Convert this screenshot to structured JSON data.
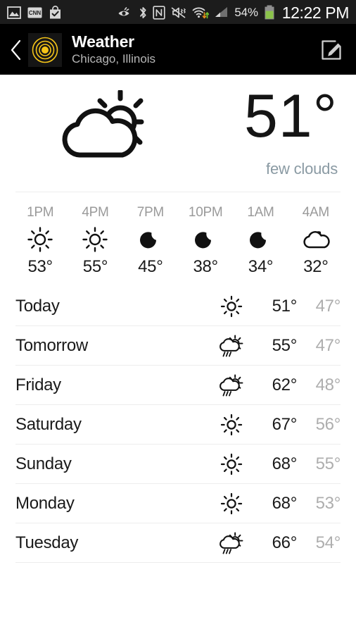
{
  "statusbar": {
    "left_icons": [
      {
        "name": "gallery-image-icon"
      },
      {
        "name": "cnn-news-icon"
      },
      {
        "name": "play-store-bag-icon"
      }
    ],
    "right_icons": [
      {
        "name": "smart-stay-eye-icon"
      },
      {
        "name": "bluetooth-icon"
      },
      {
        "name": "nfc-icon"
      },
      {
        "name": "sound-mute-vibrate-icon"
      },
      {
        "name": "wifi-data-transfer-icon"
      },
      {
        "name": "cellular-signal-icon"
      }
    ],
    "battery_percent": "54%",
    "battery_icon": "battery-icon",
    "battery_color": "#8bc34a",
    "time": "12:22 PM"
  },
  "header": {
    "back_icon": "back-chevron-icon",
    "app_icon": "weather-target-icon",
    "app_icon_color": "#f5c518",
    "title": "Weather",
    "subtitle": "Chicago, Illinois",
    "edit_icon": "edit-compose-icon"
  },
  "current": {
    "condition_icon": "partly-cloudy-day-icon",
    "temperature": "51°",
    "description": "few clouds"
  },
  "hourly": [
    {
      "time": "1PM",
      "icon": "sun-icon",
      "temp": "53°"
    },
    {
      "time": "4PM",
      "icon": "sun-icon",
      "temp": "55°"
    },
    {
      "time": "7PM",
      "icon": "moon-icon",
      "temp": "45°"
    },
    {
      "time": "10PM",
      "icon": "moon-icon",
      "temp": "38°"
    },
    {
      "time": "1AM",
      "icon": "moon-icon",
      "temp": "34°"
    },
    {
      "time": "4AM",
      "icon": "cloudy-night-icon",
      "temp": "32°"
    }
  ],
  "daily": [
    {
      "day": "Today",
      "icon": "sun-icon",
      "high": "51°",
      "low": "47°"
    },
    {
      "day": "Tomorrow",
      "icon": "rain-sun-shower-icon",
      "high": "55°",
      "low": "47°"
    },
    {
      "day": "Friday",
      "icon": "rain-sun-shower-icon",
      "high": "62°",
      "low": "48°"
    },
    {
      "day": "Saturday",
      "icon": "sun-icon",
      "high": "67°",
      "low": "56°"
    },
    {
      "day": "Sunday",
      "icon": "sun-icon",
      "high": "68°",
      "low": "55°"
    },
    {
      "day": "Monday",
      "icon": "sun-icon",
      "high": "68°",
      "low": "53°"
    },
    {
      "day": "Tuesday",
      "icon": "rain-sun-shower-icon",
      "high": "66°",
      "low": "54°"
    }
  ]
}
